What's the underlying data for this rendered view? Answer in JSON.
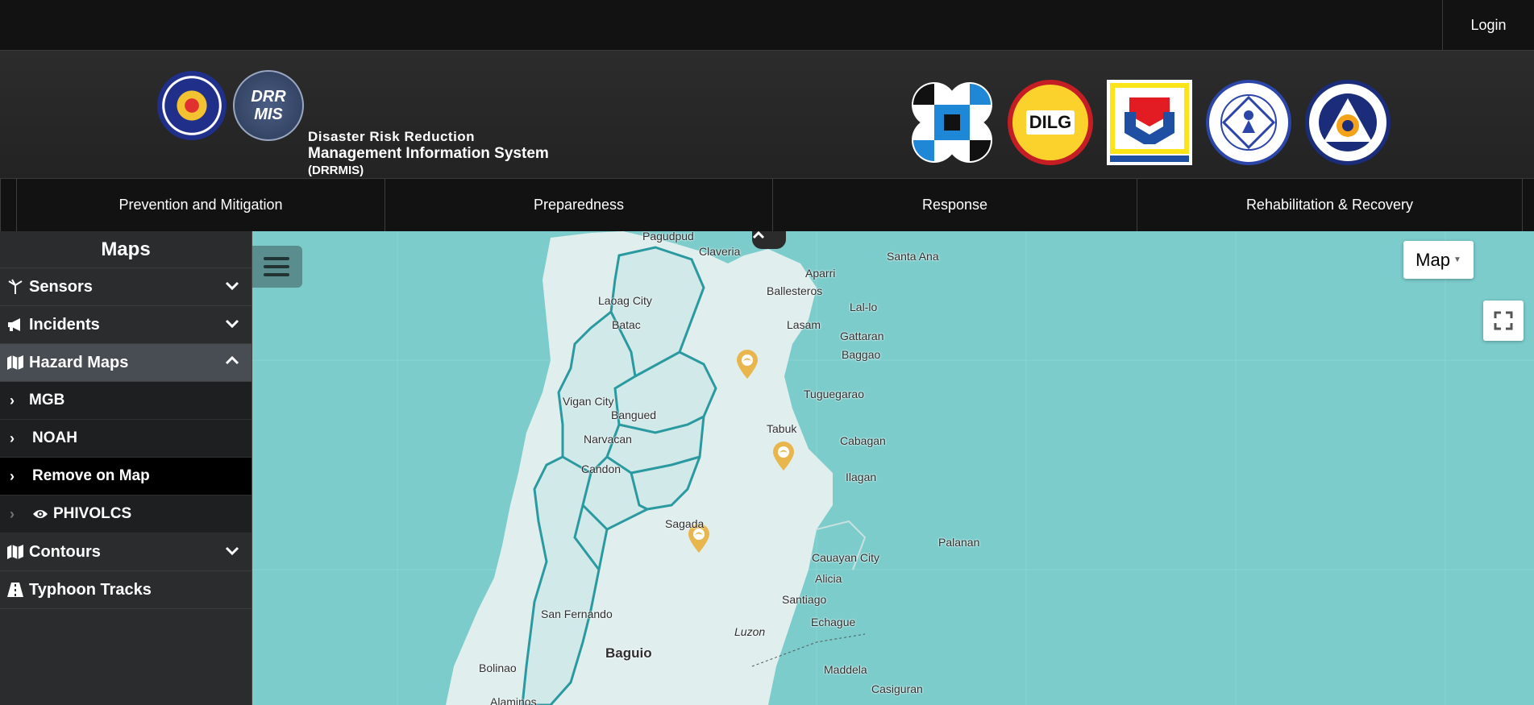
{
  "topbar": {
    "login_label": "Login"
  },
  "header": {
    "brand_line1": "Disaster Risk Reduction",
    "brand_line2": "Management Information System",
    "brand_line3": "(DRRMIS)",
    "logo_text": "DRR MIS",
    "dilg_text": "DILG"
  },
  "nav": [
    {
      "label": "Prevention and Mitigation"
    },
    {
      "label": "Preparedness"
    },
    {
      "label": "Response"
    },
    {
      "label": "Rehabilitation & Recovery"
    }
  ],
  "sidebar": {
    "title": "Maps",
    "sensors": "Sensors",
    "incidents": "Incidents",
    "hazard_maps": "Hazard Maps",
    "mgb": "MGB",
    "noah": "NOAH",
    "remove": "Remove on Map",
    "phivolcs": "PHIVOLCS",
    "contours": "Contours",
    "typhoon": "Typhoon Tracks"
  },
  "map": {
    "type_label": "Map",
    "places": {
      "pagudpud": "Pagudpud",
      "claveria": "Claveria",
      "santa_ana": "Santa Ana",
      "aparri": "Aparri",
      "ballesteros": "Ballesteros",
      "laoag": "Laoag City",
      "lallo": "Lal-lo",
      "batac": "Batac",
      "lasam": "Lasam",
      "gattaran": "Gattaran",
      "baggao": "Baggao",
      "tuguegarao": "Tuguegarao",
      "vigan": "Vigan City",
      "bangued": "Bangued",
      "tabuk": "Tabuk",
      "narvacan": "Narvacan",
      "cabagan": "Cabagan",
      "candon": "Candon",
      "ilagan": "Ilagan",
      "sagada": "Sagada",
      "palanan": "Palanan",
      "cauayan": "Cauayan City",
      "alicia": "Alicia",
      "san_fernando": "San Fernando",
      "santiago": "Santiago",
      "echague": "Echague",
      "luzon": "Luzon",
      "baguio": "Baguio",
      "bolinao": "Bolinao",
      "maddela": "Maddela",
      "casiguran": "Casiguran",
      "alaminos": "Alaminos"
    }
  },
  "colors": {
    "sea": "#7ccccc",
    "land": "#e0eeee",
    "boundary": "#2a9aa0",
    "marker": "#e8b64c"
  }
}
